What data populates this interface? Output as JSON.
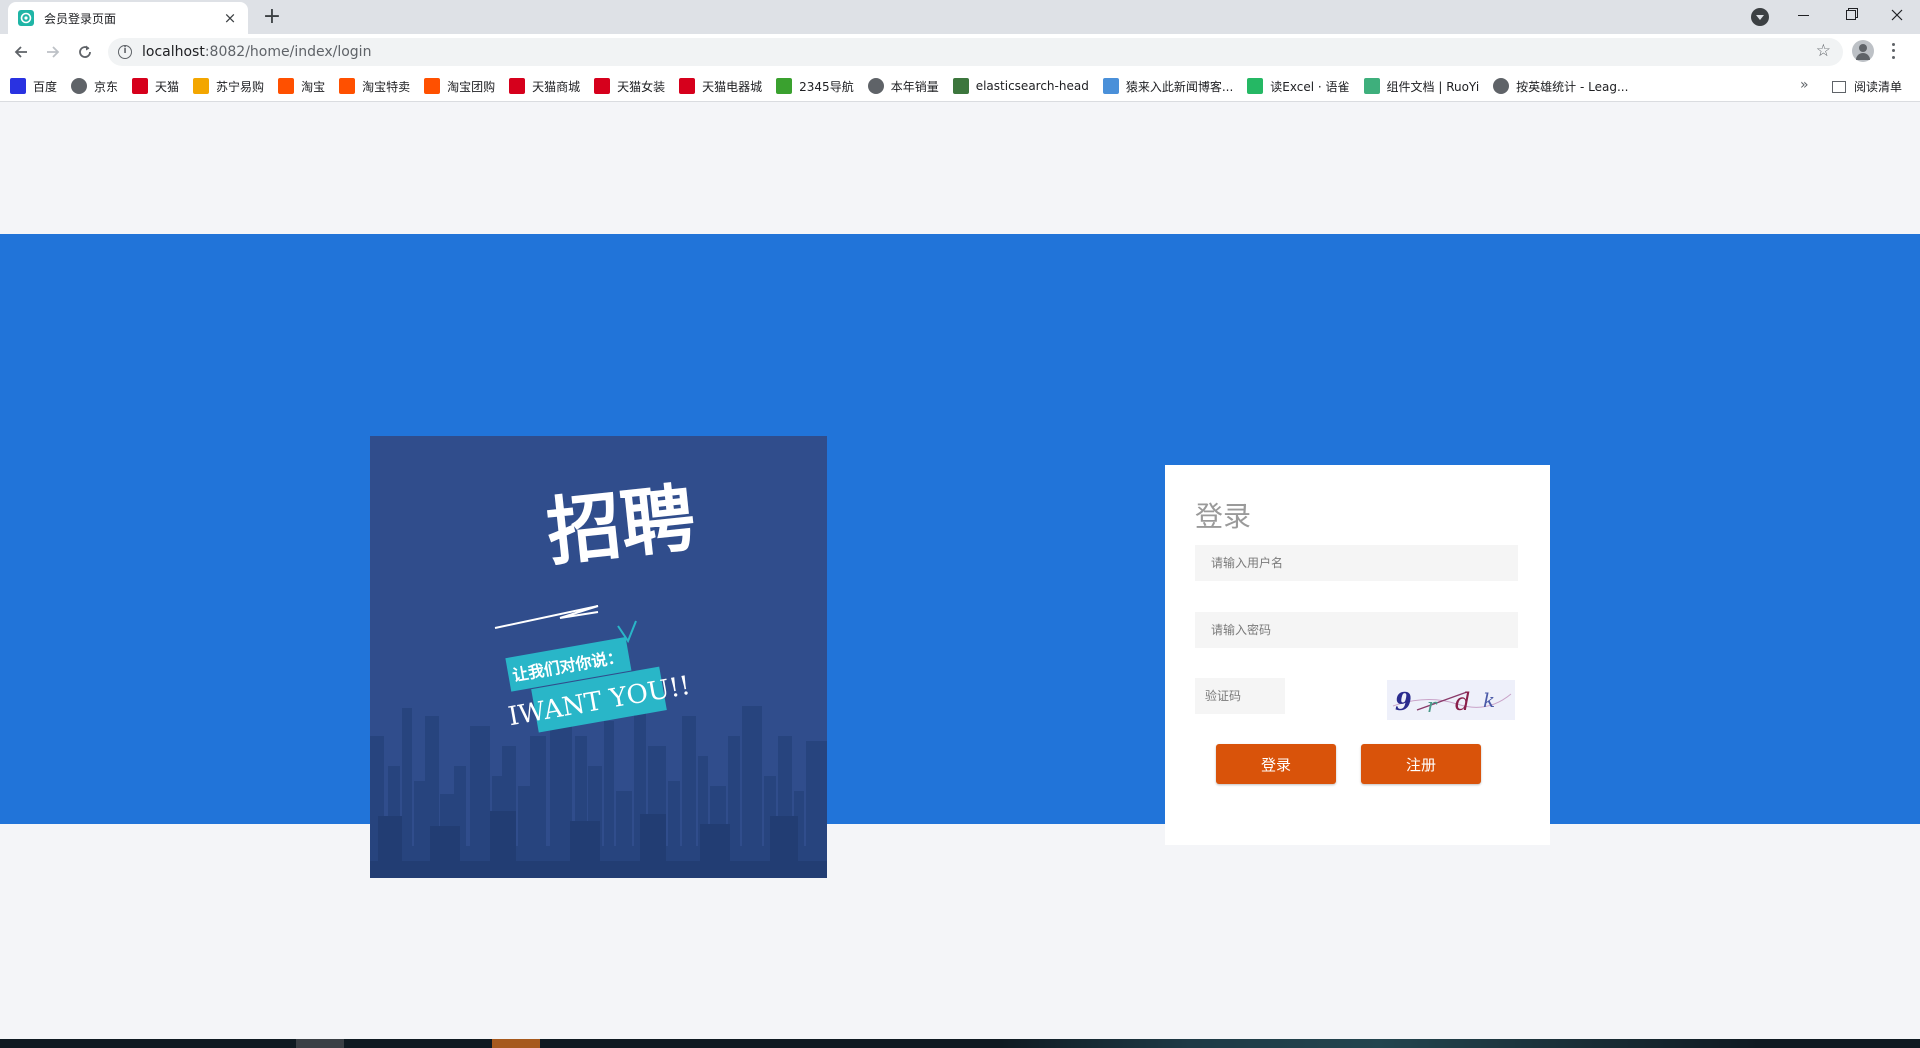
{
  "browser": {
    "tab_title": "会员登录页面",
    "tab_close": "×",
    "new_tab": "+",
    "url_host": "localhost",
    "url_path": ":8082/home/index/login",
    "bookmarks": [
      {
        "label": "百度",
        "icon": "baidu-paw-icon",
        "color": "#2932e1"
      },
      {
        "label": "京东",
        "icon": "globe-icon",
        "color": "#5f6368"
      },
      {
        "label": "天猫",
        "icon": "tmall-icon",
        "color": "#d6001c"
      },
      {
        "label": "苏宁易购",
        "icon": "suning-icon",
        "color": "#f3a600"
      },
      {
        "label": "淘宝",
        "icon": "taobao-icon",
        "color": "#ff5000"
      },
      {
        "label": "淘宝特卖",
        "icon": "taobao-icon",
        "color": "#ff5000"
      },
      {
        "label": "淘宝团购",
        "icon": "taobao-icon",
        "color": "#ff5000"
      },
      {
        "label": "天猫商城",
        "icon": "tmall-icon",
        "color": "#d6001c"
      },
      {
        "label": "天猫女装",
        "icon": "tmall-icon",
        "color": "#d6001c"
      },
      {
        "label": "天猫电器城",
        "icon": "tmall-icon",
        "color": "#d6001c"
      },
      {
        "label": "2345导航",
        "icon": "2345-icon",
        "color": "#3aa12f"
      },
      {
        "label": "本年销量",
        "icon": "globe-icon",
        "color": "#5f6368"
      },
      {
        "label": "elasticsearch-head",
        "icon": "elastic-icon",
        "color": "#3c763d"
      },
      {
        "label": "猿来入此新闻博客...",
        "icon": "yuanlai-icon",
        "color": "#4a90d9"
      },
      {
        "label": "读Excel · 语雀",
        "icon": "yuque-icon",
        "color": "#25b864"
      },
      {
        "label": "组件文档 | RuoYi",
        "icon": "ruoyi-icon",
        "color": "#3eaf7c"
      },
      {
        "label": "按英雄统计 - Leag...",
        "icon": "globe-icon",
        "color": "#5f6368"
      }
    ],
    "bookmarks_overflow": "»",
    "reading_list": "阅读清单"
  },
  "poster": {
    "headline": "招聘",
    "banner_line1": "让我们对你说：",
    "banner_line2": "IWANT YOU!!"
  },
  "login": {
    "title": "登录",
    "username_placeholder": "请输入用户名",
    "password_placeholder": "请输入密码",
    "captcha_placeholder": "验证码",
    "captcha_text": [
      "9",
      "r",
      "d",
      "k"
    ],
    "login_button": "登录",
    "register_button": "注册"
  },
  "colors": {
    "page_bg": "#f4f5f8",
    "band": "#2174d9",
    "poster_bg": "#304d8c",
    "button": "#d9530a",
    "banner": "#29b6c8"
  }
}
